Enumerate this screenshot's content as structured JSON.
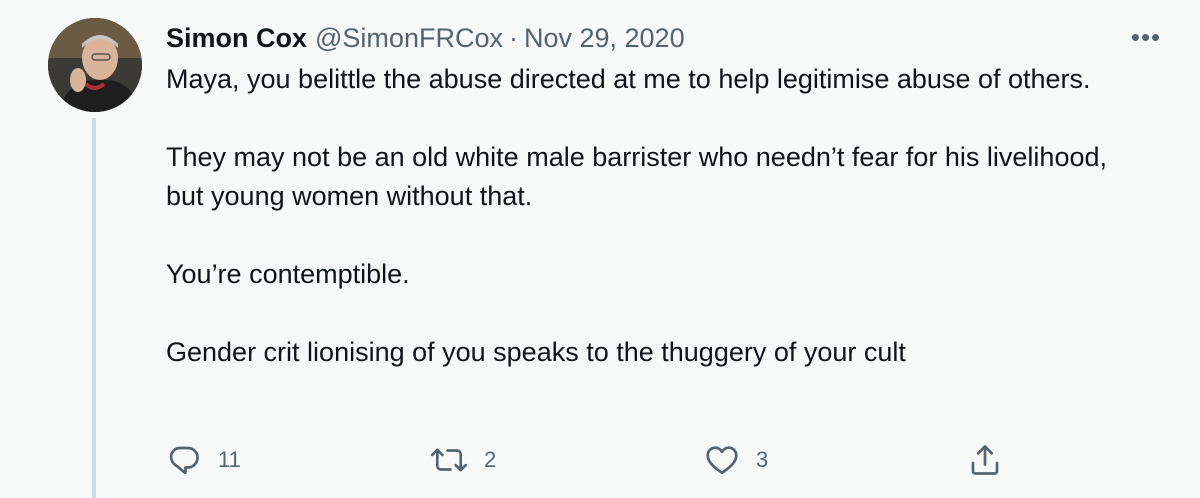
{
  "tweet": {
    "author_name": "Simon Cox",
    "author_handle": "@SimonFRCox",
    "separator": "·",
    "date": "Nov 29, 2020",
    "more_label": "•••",
    "paragraphs": [
      "Maya, you belittle the abuse directed at me to help legitimise abuse of others.",
      "They may not be an old white male barrister who needn’t fear for his livelihood, but young women without that.",
      "You’re contemptible.",
      "Gender crit lionising of you speaks to the thuggery of your cult"
    ]
  },
  "actions": {
    "reply": {
      "icon": "reply-icon",
      "count": "11"
    },
    "retweet": {
      "icon": "retweet-icon",
      "count": "2"
    },
    "like": {
      "icon": "like-icon",
      "count": "3"
    },
    "share": {
      "icon": "share-icon"
    }
  },
  "colors": {
    "background": "#f7f9f9",
    "text_primary": "#0f1419",
    "text_secondary": "#536471",
    "thread_line": "#cfd9de"
  }
}
